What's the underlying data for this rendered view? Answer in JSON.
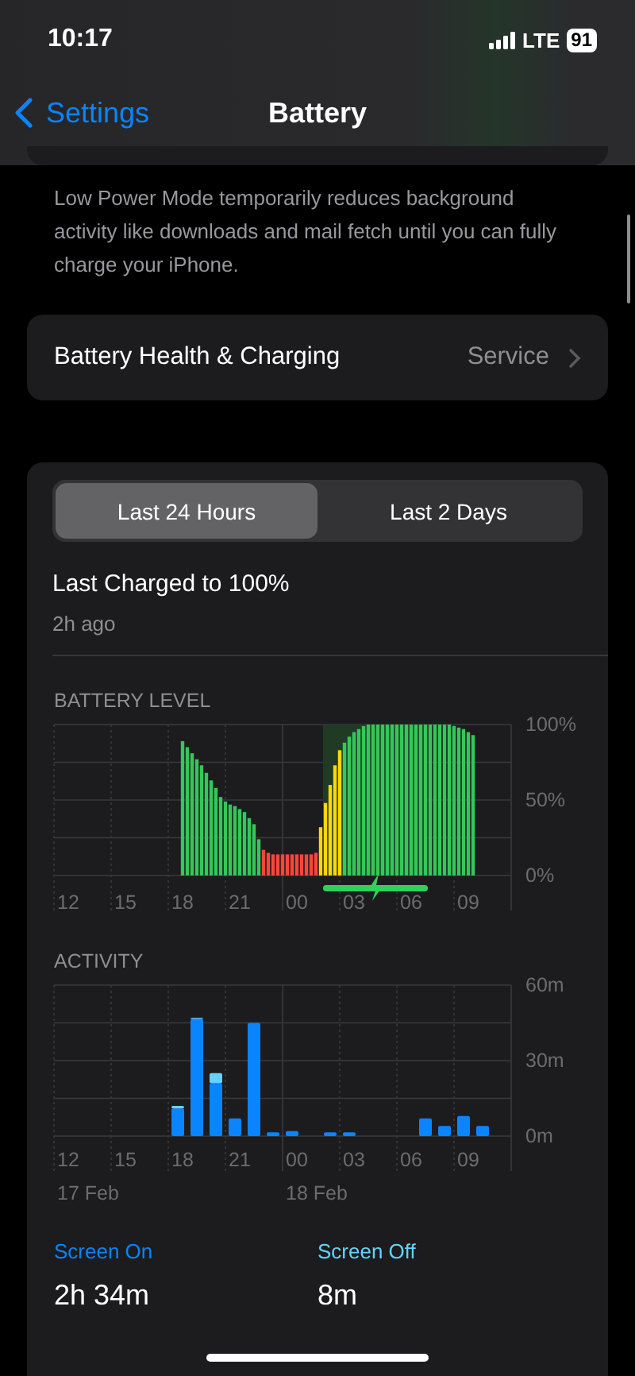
{
  "status_bar": {
    "time": "10:17",
    "network": "LTE",
    "battery": "91"
  },
  "nav": {
    "back": "Settings",
    "title": "Battery"
  },
  "low_power_note": "Low Power Mode temporarily reduces background activity like downloads and mail fetch until you can fully charge your iPhone.",
  "health_row": {
    "label": "Battery Health & Charging",
    "value": "Service"
  },
  "usage": {
    "tabs": [
      {
        "label": "Last 24 Hours",
        "selected": true
      },
      {
        "label": "Last 2 Days",
        "selected": false
      }
    ],
    "last_charged": "Last Charged to 100%",
    "last_charged_time": "2h ago",
    "battery_level": {
      "title": "BATTERY LEVEL",
      "time_labels": [
        "12",
        "15",
        "18",
        "21",
        "00",
        "03",
        "06",
        "09"
      ],
      "charging": [
        false,
        false,
        false,
        false,
        false,
        false,
        false,
        false,
        false,
        false,
        false,
        false,
        false,
        false,
        false,
        false,
        false,
        false,
        false,
        false,
        false,
        false,
        false,
        false,
        false,
        false,
        false,
        false,
        false,
        false,
        true,
        true,
        true,
        true,
        true,
        true,
        true,
        true,
        true,
        true,
        true,
        true,
        true,
        true,
        true,
        true,
        true,
        true,
        true,
        true,
        true,
        true,
        false,
        false,
        false,
        false,
        false,
        false,
        false,
        false,
        false,
        false
      ],
      "chart_data": {
        "type": "bar",
        "stacked": true,
        "ylim": [
          0,
          100
        ],
        "yticks": [
          {
            "value": 100,
            "label": "100%"
          },
          {
            "value": 50,
            "label": "50%"
          },
          {
            "value": 0,
            "label": "0%"
          }
        ],
        "categories": [
          null,
          null,
          null,
          null,
          null,
          null,
          null,
          null,
          null,
          null,
          null,
          null,
          null,
          null,
          null,
          null,
          null,
          null,
          null,
          null,
          null,
          null,
          null,
          null,
          null,
          null,
          null,
          null,
          null,
          null,
          null,
          null,
          null,
          null,
          null,
          null,
          null,
          null,
          null,
          null,
          null,
          null,
          null,
          null,
          null,
          null,
          null,
          null,
          null,
          null,
          null,
          null,
          null,
          null,
          null,
          null,
          null,
          null,
          null,
          null,
          null,
          null
        ],
        "series": [
          {
            "color": "#34c759",
            "values": [
              89,
              85,
              81,
              77,
              73,
              68,
              63,
              58,
              52,
              49,
              47,
              46,
              44,
              42,
              38,
              34,
              24,
              0,
              0,
              0,
              0,
              0,
              0,
              0,
              0,
              0,
              0,
              0,
              0,
              0,
              0,
              0,
              0,
              0,
              88,
              92,
              95,
              97,
              99,
              100,
              100,
              100,
              100,
              100,
              100,
              100,
              100,
              100,
              100,
              100,
              100,
              100,
              100,
              100,
              100,
              100,
              100,
              99,
              98,
              97,
              95,
              93
            ]
          },
          {
            "color": "#ff453a",
            "values": [
              0,
              0,
              0,
              0,
              0,
              0,
              0,
              0,
              0,
              0,
              0,
              0,
              0,
              0,
              0,
              0,
              0,
              17,
              15,
              14,
              14,
              14,
              14,
              14,
              14,
              14,
              14,
              14,
              15,
              0,
              0,
              0,
              0,
              0,
              0,
              0,
              0,
              0,
              0,
              0,
              0,
              0,
              0,
              0,
              0,
              0,
              0,
              0,
              0,
              0,
              0,
              0,
              0,
              0,
              0,
              0,
              0,
              0,
              0,
              0,
              0,
              0
            ]
          },
          {
            "color": "#ffd60a",
            "values": [
              0,
              0,
              0,
              0,
              0,
              0,
              0,
              0,
              0,
              0,
              0,
              0,
              0,
              0,
              0,
              0,
              0,
              0,
              0,
              0,
              0,
              0,
              0,
              0,
              0,
              0,
              0,
              0,
              0,
              32,
              48,
              60,
              73,
              83,
              0,
              0,
              0,
              0,
              0,
              0,
              0,
              0,
              0,
              0,
              0,
              0,
              0,
              0,
              0,
              0,
              0,
              0,
              0,
              0,
              0,
              0,
              0,
              0,
              0,
              0,
              0,
              0
            ]
          }
        ]
      }
    },
    "activity": {
      "title": "ACTIVITY",
      "time_labels": [
        "12",
        "15",
        "18",
        "21",
        "00",
        "03",
        "06",
        "09"
      ],
      "dates": [
        "17 Feb",
        "18 Feb"
      ],
      "chart_data": {
        "type": "bar",
        "stacked": true,
        "ylim": [
          0,
          60
        ],
        "yticks": [
          {
            "value": 60,
            "label": "60m"
          },
          {
            "value": 30,
            "label": "30m"
          },
          {
            "value": 0,
            "label": "0m"
          }
        ],
        "categories": [
          null,
          null,
          null,
          null,
          null,
          null,
          null,
          null,
          null,
          null,
          null,
          null,
          null,
          null,
          null,
          null,
          null,
          null,
          null,
          null,
          null,
          null,
          null,
          null
        ],
        "series": [
          {
            "color": "#0a84ff",
            "values": [
              0,
              0,
              0,
              0,
              0,
              0,
              11,
              46.5,
              21,
              7,
              45,
              1.5,
              2,
              0,
              1.5,
              1.5,
              0,
              0,
              0,
              7,
              4,
              8,
              4,
              0
            ]
          },
          {
            "color": "#64d2ff",
            "values": [
              0,
              0,
              0,
              0,
              0,
              0,
              1,
              0.5,
              4,
              0,
              0,
              0,
              0,
              0,
              0,
              0,
              0,
              0,
              0,
              0,
              0,
              0,
              0,
              0
            ]
          }
        ]
      }
    },
    "screen_stats": [
      {
        "label": "Screen On",
        "value": "2h 34m"
      },
      {
        "label": "Screen Off",
        "value": "8m"
      }
    ]
  }
}
